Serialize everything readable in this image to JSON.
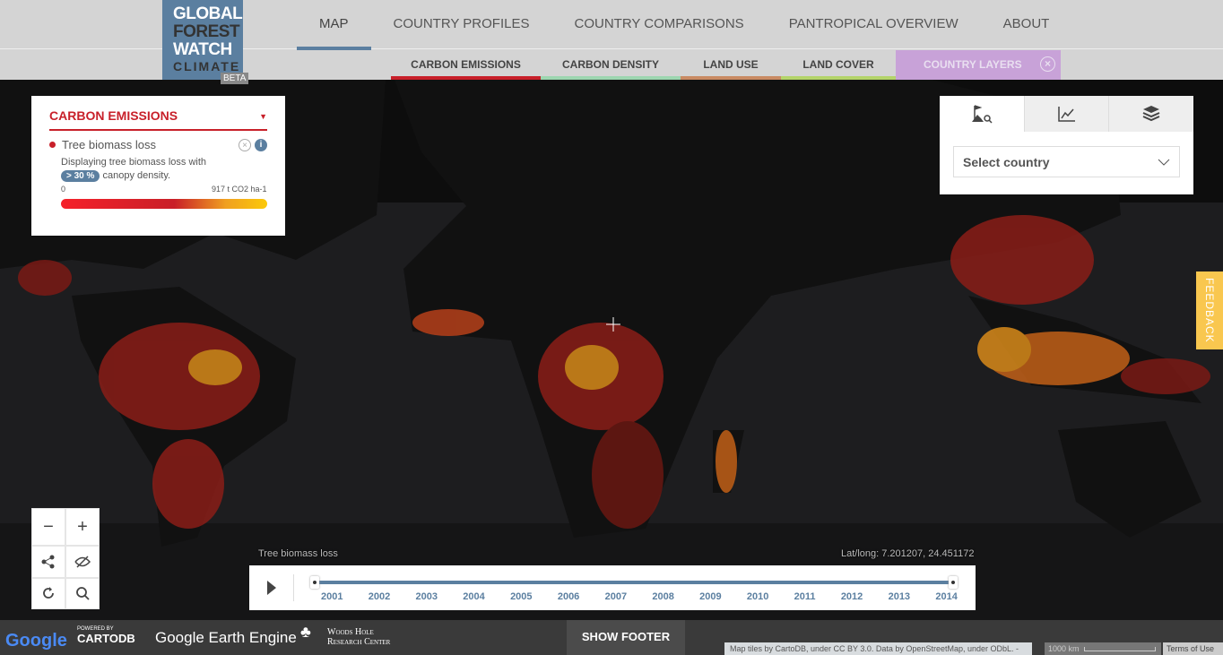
{
  "header": {
    "logo": [
      "GLOBAL",
      "FOREST",
      "WATCH",
      "CLIMATE"
    ],
    "beta": "BETA",
    "nav": [
      {
        "label": "MAP",
        "active": true
      },
      {
        "label": "COUNTRY PROFILES"
      },
      {
        "label": "COUNTRY COMPARISONS"
      },
      {
        "label": "PANTROPICAL OVERVIEW"
      },
      {
        "label": "ABOUT"
      }
    ],
    "subnav": [
      {
        "label": "CARBON EMISSIONS",
        "color": "#c8202a"
      },
      {
        "label": "CARBON DENSITY",
        "color": "#9dd6b0"
      },
      {
        "label": "LAND USE",
        "color": "#c98a63"
      },
      {
        "label": "LAND COVER",
        "color": "#b4d46a"
      },
      {
        "label": "COUNTRY LAYERS",
        "color": "#c8a2d8"
      }
    ]
  },
  "legend": {
    "title": "CARBON EMISSIONS",
    "layer": "Tree biomass loss",
    "desc_pre": "Displaying tree biomass loss with",
    "threshold": "> 30 %",
    "desc_post": "canopy density.",
    "min": "0",
    "max": "917 t CO2 ha-1",
    "gradient": [
      "#f5212a",
      "#c91f28",
      "#f0a020",
      "#fbc90a"
    ]
  },
  "tools": {
    "tabs": [
      "country-search-icon",
      "chart-icon",
      "layers-icon"
    ],
    "select_placeholder": "Select country"
  },
  "feedback": "FEEDBACK",
  "map": {
    "layer_label": "Tree biomass loss",
    "latlong": "Lat/long: 7.201207, 24.451172"
  },
  "timeline": {
    "years": [
      "2001",
      "2002",
      "2003",
      "2004",
      "2005",
      "2006",
      "2007",
      "2008",
      "2009",
      "2010",
      "2011",
      "2012",
      "2013",
      "2014"
    ],
    "range": [
      "2001",
      "2014"
    ]
  },
  "footer": {
    "google": "Google",
    "cartodb_small": "POWERED BY",
    "cartodb": "CARTODB",
    "earth": "Google Earth Engine",
    "woods1": "Woods Hole",
    "woods2": "Research Center",
    "show": "SHOW FOOTER",
    "attrib": "Map tiles by CartoDB, under CC BY 3.0. Data by OpenStreetMap, under ODbL. -",
    "scale": "1000 km",
    "terms": "Terms of Use"
  }
}
